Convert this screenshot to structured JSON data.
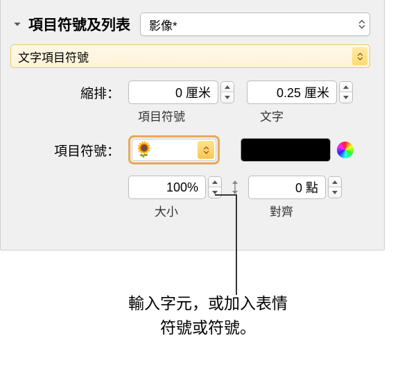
{
  "header": {
    "title": "項目符號及列表",
    "style_select": "影像*"
  },
  "bullet_type_select": "文字項目符號",
  "indent": {
    "label": "縮排：",
    "bullet_value": "0 厘米",
    "text_value": "0.25 厘米",
    "bullet_sublabel": "項目符號",
    "text_sublabel": "文字"
  },
  "bullet": {
    "label": "項目符號：",
    "symbol": "🌻",
    "color": "#000000"
  },
  "size": {
    "value": "100%",
    "label": "大小"
  },
  "align": {
    "value": "0 點",
    "label": "對齊"
  },
  "callout": {
    "line1": "輸入字元，或加入表情",
    "line2": "符號或符號。"
  }
}
